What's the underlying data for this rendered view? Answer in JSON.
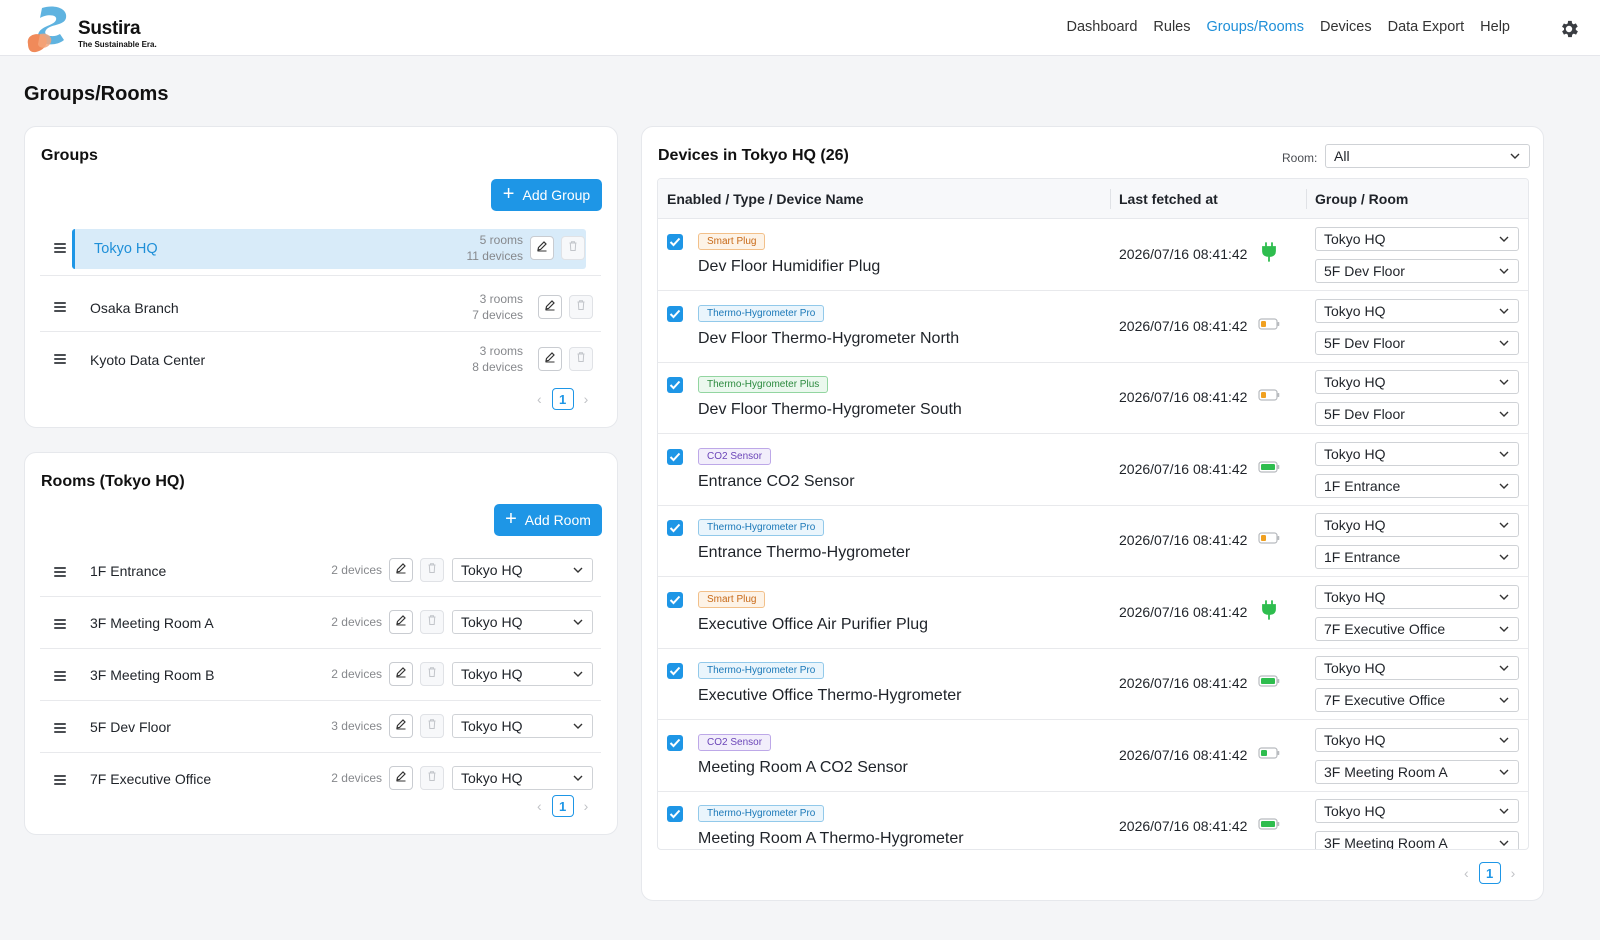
{
  "brand": {
    "name": "Sustira",
    "tagline": "The Sustainable Era."
  },
  "nav": [
    "Dashboard",
    "Rules",
    "Groups/Rooms",
    "Devices",
    "Data Export",
    "Help"
  ],
  "nav_active": "Groups/Rooms",
  "page_title": "Groups/Rooms",
  "groups": {
    "title": "Groups",
    "add_label": "Add Group",
    "items": [
      {
        "name": "Tokyo HQ",
        "rooms": "5 rooms",
        "devices": "11 devices"
      },
      {
        "name": "Osaka Branch",
        "rooms": "3 rooms",
        "devices": "7 devices"
      },
      {
        "name": "Kyoto Data Center",
        "rooms": "3 rooms",
        "devices": "8 devices"
      }
    ],
    "page": "1"
  },
  "rooms": {
    "title": "Rooms  (Tokyo HQ)",
    "add_label": "Add Room",
    "items": [
      {
        "name": "1F Entrance",
        "devices": "2 devices",
        "group": "Tokyo HQ"
      },
      {
        "name": "3F Meeting Room A",
        "devices": "2 devices",
        "group": "Tokyo HQ"
      },
      {
        "name": "3F Meeting Room B",
        "devices": "2 devices",
        "group": "Tokyo HQ"
      },
      {
        "name": "5F Dev Floor",
        "devices": "3 devices",
        "group": "Tokyo HQ"
      },
      {
        "name": "7F Executive Office",
        "devices": "2 devices",
        "group": "Tokyo HQ"
      }
    ],
    "page": "1"
  },
  "devices": {
    "title": "Devices in Tokyo HQ  (26)",
    "room_filter_label": "Room:",
    "room_filter_value": "All",
    "columns": [
      "Enabled / Type / Device Name",
      "Last fetched at",
      "Group / Room"
    ],
    "items": [
      {
        "type": "Smart Plug",
        "type_class": "plug",
        "name": "Dev Floor Humidifier Plug",
        "time": "2026/07/16 08:41:42",
        "status": "plug-icon",
        "group": "Tokyo HQ",
        "room": "5F Dev Floor"
      },
      {
        "type": "Thermo-Hygrometer Pro",
        "type_class": "pro",
        "name": "Dev Floor Thermo-Hygrometer North",
        "time": "2026/07/16 08:41:42",
        "status": "battery-low-icon",
        "group": "Tokyo HQ",
        "room": "5F Dev Floor"
      },
      {
        "type": "Thermo-Hygrometer Plus",
        "type_class": "plus",
        "name": "Dev Floor Thermo-Hygrometer South",
        "time": "2026/07/16 08:41:42",
        "status": "battery-low-icon",
        "group": "Tokyo HQ",
        "room": "5F Dev Floor"
      },
      {
        "type": "CO2 Sensor",
        "type_class": "co2",
        "name": "Entrance CO2 Sensor",
        "time": "2026/07/16 08:41:42",
        "status": "battery-full-icon",
        "group": "Tokyo HQ",
        "room": "1F Entrance"
      },
      {
        "type": "Thermo-Hygrometer Pro",
        "type_class": "pro",
        "name": "Entrance Thermo-Hygrometer",
        "time": "2026/07/16 08:41:42",
        "status": "battery-low-icon",
        "group": "Tokyo HQ",
        "room": "1F Entrance"
      },
      {
        "type": "Smart Plug",
        "type_class": "plug",
        "name": "Executive Office Air Purifier Plug",
        "time": "2026/07/16 08:41:42",
        "status": "plug-icon",
        "group": "Tokyo HQ",
        "room": "7F Executive Office"
      },
      {
        "type": "Thermo-Hygrometer Pro",
        "type_class": "pro",
        "name": "Executive Office Thermo-Hygrometer",
        "time": "2026/07/16 08:41:42",
        "status": "battery-full-icon",
        "group": "Tokyo HQ",
        "room": "7F Executive Office"
      },
      {
        "type": "CO2 Sensor",
        "type_class": "co2",
        "name": "Meeting Room A CO2 Sensor",
        "time": "2026/07/16 08:41:42",
        "status": "battery-mid-icon",
        "group": "Tokyo HQ",
        "room": "3F Meeting Room A"
      },
      {
        "type": "Thermo-Hygrometer Pro",
        "type_class": "pro",
        "name": "Meeting Room A Thermo-Hygrometer",
        "time": "2026/07/16 08:41:42",
        "status": "battery-full-icon",
        "group": "Tokyo HQ",
        "room": "3F Meeting Room A"
      }
    ],
    "page": "1"
  },
  "colors": {
    "accent": "#1e96e6",
    "battery_green": "#2ebd4e",
    "battery_orange": "#f0a020"
  }
}
